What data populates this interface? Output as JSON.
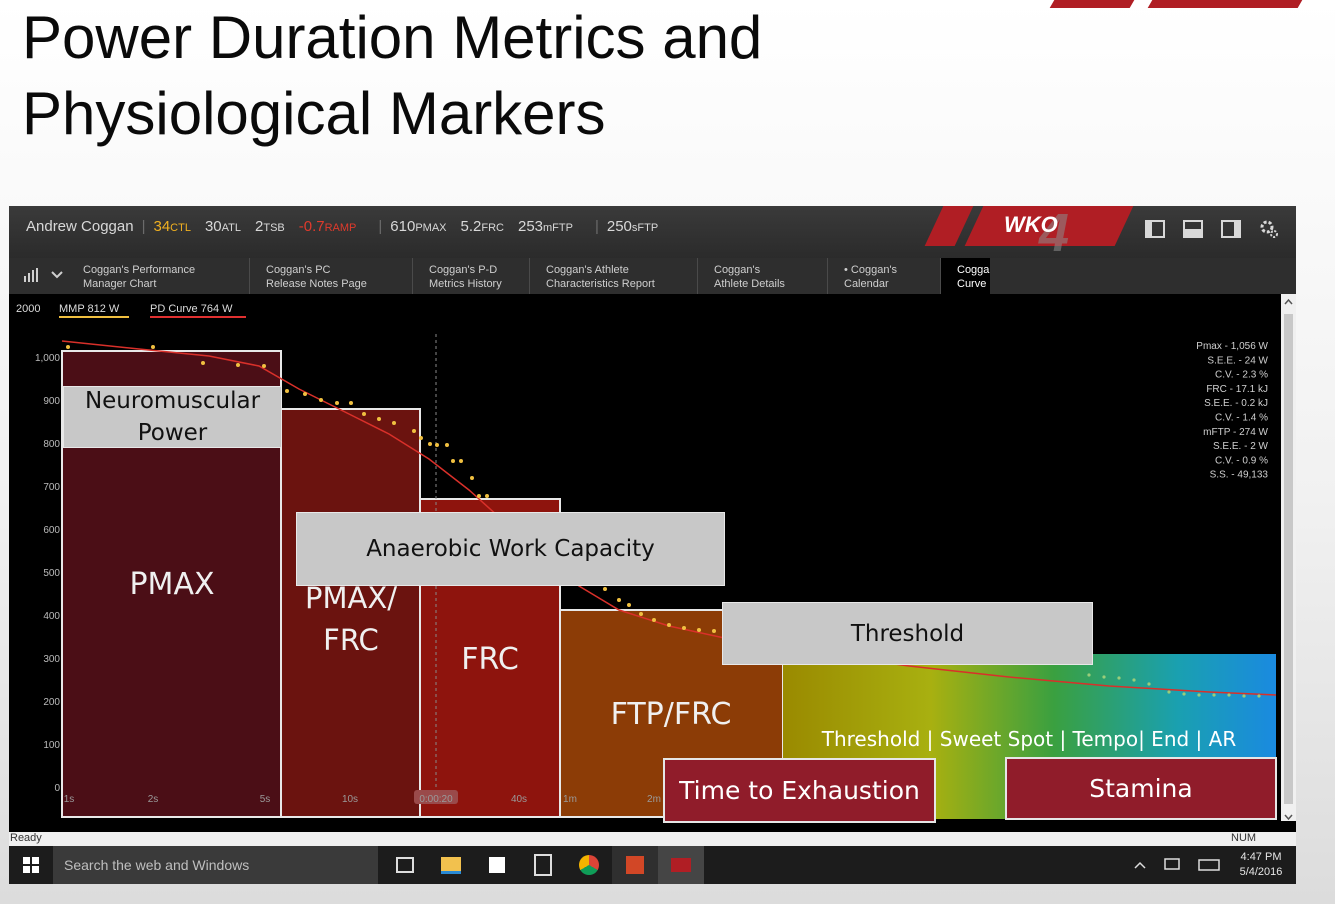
{
  "slide": {
    "title_line1": "Power Duration Metrics and",
    "title_line2": "Physiological Markers"
  },
  "app": {
    "athlete": "Andrew Coggan",
    "metrics": [
      {
        "value": "34",
        "unit": "CTL",
        "color": "#f0b020"
      },
      {
        "value": "30",
        "unit": "ATL",
        "color": "#d8d8d8"
      },
      {
        "value": "2",
        "unit": "TSB",
        "color": "#d8d8d8"
      },
      {
        "value": "-0.7",
        "unit": "RAMP",
        "color": "#e03a2c"
      },
      {
        "value": "610",
        "unit": "PMAX",
        "color": "#d8d8d8"
      },
      {
        "value": "5.2",
        "unit": "FRC",
        "color": "#d8d8d8"
      },
      {
        "value": "253",
        "unit": "mFTP",
        "color": "#d8d8d8"
      },
      {
        "value": "250",
        "unit": "sFTP",
        "color": "#d8d8d8"
      }
    ],
    "logo_text": "WKO",
    "logo_digit": "4",
    "tabs": [
      {
        "line1": "Coggan's Performance",
        "line2": "Manager Chart"
      },
      {
        "line1": "Coggan's PC",
        "line2": "Release Notes Page"
      },
      {
        "line1": "Coggan's P-D",
        "line2": "Metrics History"
      },
      {
        "line1": "Coggan's Athlete",
        "line2": "Characteristics Report"
      },
      {
        "line1": "Coggan's",
        "line2": "Athlete Details"
      },
      {
        "line1": "• Coggan's",
        "line2": "Calendar"
      },
      {
        "line1": "Cogga",
        "line2": "Curve"
      }
    ],
    "status_left": "Ready",
    "status_right": "NUM"
  },
  "chart_data": {
    "type": "line",
    "ymax_label": "2000",
    "legend": [
      {
        "name": "MMP",
        "value": "812 W",
        "color": "#f0c040"
      },
      {
        "name": "PD Curve",
        "value": "764 W",
        "color": "#e03030"
      }
    ],
    "y_ticks": [
      "1,000",
      "900",
      "800",
      "700",
      "600",
      "500",
      "400",
      "300",
      "200",
      "100",
      "0"
    ],
    "x_ticks": [
      "1s",
      "2s",
      "5s",
      "10s",
      "0:00:20",
      "40s",
      "1m",
      "2m"
    ],
    "model_stats": [
      "Pmax - 1,056 W",
      "S.E.E. - 24 W",
      "C.V. - 2.3 %",
      "FRC - 17.1 kJ",
      "S.E.E. - 0.2 kJ",
      "C.V. - 1.4 %",
      "mFTP - 274 W",
      "S.E.E. - 2 W",
      "C.V. - 0.9 %",
      "S.S. - 49,133"
    ],
    "zones": [
      {
        "label": "PMAX",
        "color": "#4b0e16"
      },
      {
        "label": "PMAX/ FRC",
        "color": "#6b130f"
      },
      {
        "label": "FRC",
        "color": "#8e140d"
      },
      {
        "label": "FTP/FRC",
        "color": "#8c3c06"
      }
    ],
    "overlays": {
      "neuromuscular": "Neuromuscular Power",
      "anaerobic": "Anaerobic Work Capacity",
      "threshold": "Threshold",
      "bands": "Threshold | Sweet Spot | Tempo| End | AR",
      "tte": "Time to Exhaustion",
      "stamina": "Stamina"
    }
  },
  "taskbar": {
    "search_placeholder": "Search the web and Windows",
    "time": "4:47 PM",
    "date": "5/4/2016"
  }
}
